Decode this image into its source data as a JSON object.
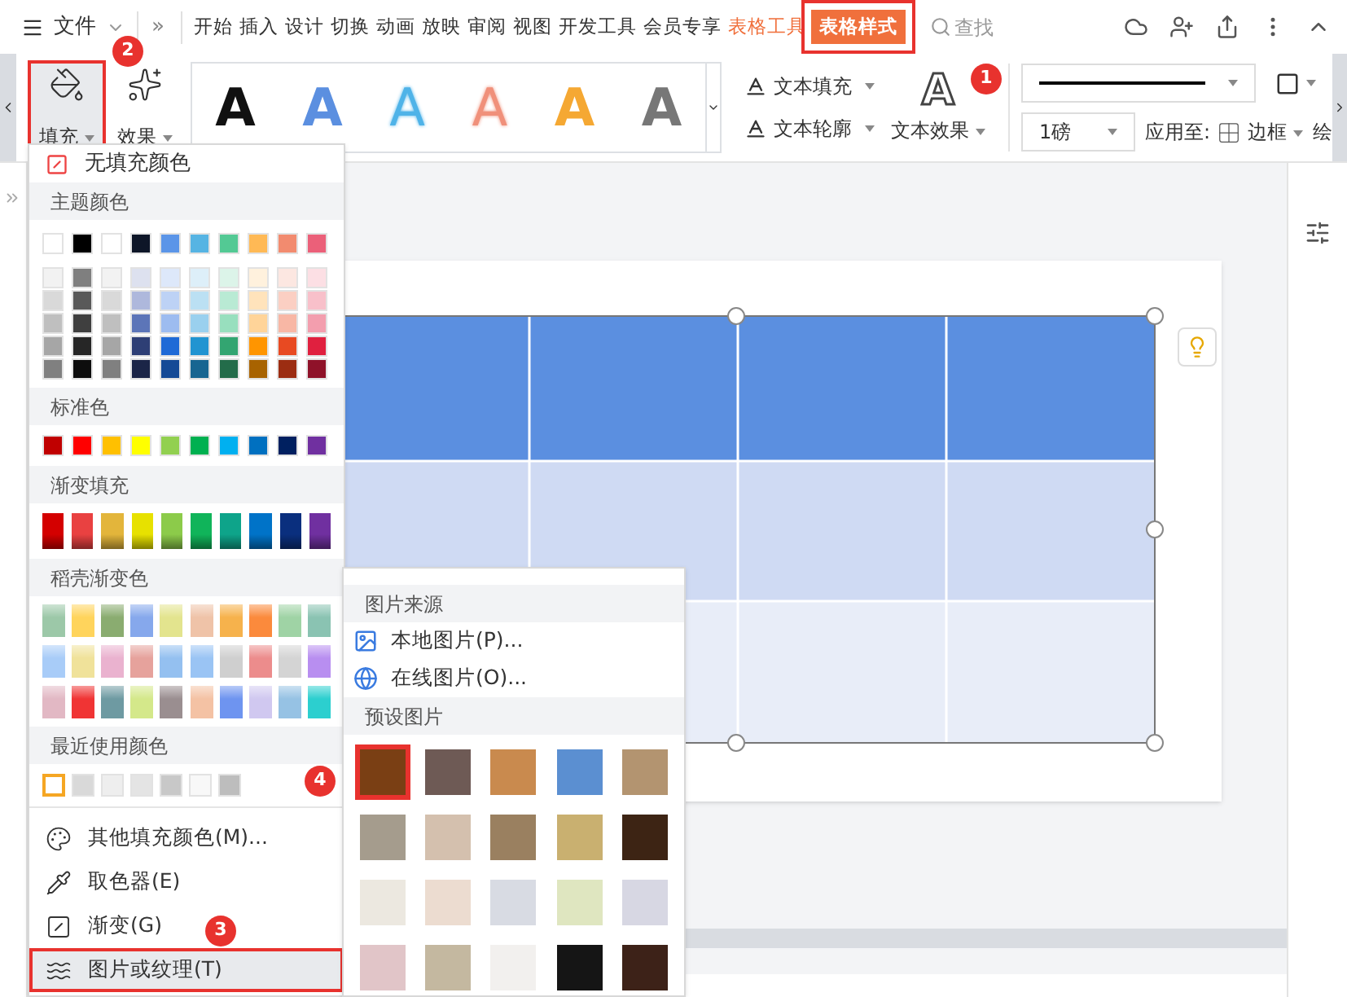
{
  "menu_bar": {
    "file_label": "文件",
    "overflow_label": "»"
  },
  "tabs": [
    {
      "label": "开始",
      "kind": "normal",
      "selected": false
    },
    {
      "label": "插入",
      "kind": "normal",
      "selected": false
    },
    {
      "label": "设计",
      "kind": "normal",
      "selected": false
    },
    {
      "label": "切换",
      "kind": "normal",
      "selected": false
    },
    {
      "label": "动画",
      "kind": "normal",
      "selected": false
    },
    {
      "label": "放映",
      "kind": "normal",
      "selected": false
    },
    {
      "label": "审阅",
      "kind": "normal",
      "selected": false
    },
    {
      "label": "视图",
      "kind": "normal",
      "selected": false
    },
    {
      "label": "开发工具",
      "kind": "normal",
      "selected": false
    },
    {
      "label": "会员专享",
      "kind": "normal",
      "selected": false
    },
    {
      "label": "表格工具",
      "kind": "context",
      "selected": false
    },
    {
      "label": "表格样式",
      "kind": "context",
      "selected": true
    }
  ],
  "search": {
    "label": "查找"
  },
  "ribbon": {
    "fill_button": {
      "label": "填充",
      "pressed": true
    },
    "effect_button": {
      "label": "效果"
    },
    "text_styles": [
      {
        "glyph": "A",
        "kind": "fill",
        "color": "#111111"
      },
      {
        "glyph": "A",
        "kind": "fill",
        "color": "#5b8fe0"
      },
      {
        "glyph": "A",
        "kind": "outline",
        "color": "#4fb3e8"
      },
      {
        "glyph": "A",
        "kind": "outline",
        "color": "#f0907a"
      },
      {
        "glyph": "A",
        "kind": "fill",
        "color": "#f5a833"
      },
      {
        "glyph": "A",
        "kind": "fill",
        "color": "#777777"
      }
    ],
    "text_fill": "文本填充",
    "text_outline": "文本轮廓",
    "text_effect_glyph": "A",
    "text_effect": "文本效果",
    "line_weight": "1磅",
    "apply_to": "应用至:",
    "border": "边框",
    "draw": "绘"
  },
  "fill_menu": {
    "no_fill": "无填充颜色",
    "theme_header": "主题颜色",
    "theme_top": [
      {
        "color": "#ffffff"
      },
      {
        "color": "#000000"
      },
      {
        "color": "#ffffff"
      },
      {
        "color": "#0e1628"
      },
      {
        "color": "#5b95e8"
      },
      {
        "color": "#56b4e3"
      },
      {
        "color": "#53c994"
      },
      {
        "color": "#ffb955"
      },
      {
        "color": "#f28b6f"
      },
      {
        "color": "#eb6079"
      }
    ],
    "theme_shades": [
      [
        {
          "color": "#f2f2f2"
        },
        {
          "color": "#7f7f7f"
        },
        {
          "color": "#f2f2f2"
        },
        {
          "color": "#dde1ef"
        },
        {
          "color": "#dde8fa"
        },
        {
          "color": "#ddeff9"
        },
        {
          "color": "#dcf4e9"
        },
        {
          "color": "#fff1dd"
        },
        {
          "color": "#fce7e1"
        },
        {
          "color": "#fcdfe4"
        }
      ],
      [
        {
          "color": "#d9d9d9"
        },
        {
          "color": "#595959"
        },
        {
          "color": "#d9d9d9"
        },
        {
          "color": "#aeb8dc"
        },
        {
          "color": "#bdd2f5"
        },
        {
          "color": "#bbe0f3"
        },
        {
          "color": "#b9ead4"
        },
        {
          "color": "#ffe3bb"
        },
        {
          "color": "#fbcfc3"
        },
        {
          "color": "#f8c0ca"
        }
      ],
      [
        {
          "color": "#bfbfbf"
        },
        {
          "color": "#3f3f3f"
        },
        {
          "color": "#bfbfbf"
        },
        {
          "color": "#5c75b8"
        },
        {
          "color": "#9dbcf0"
        },
        {
          "color": "#9ad0ee"
        },
        {
          "color": "#98dfbe"
        },
        {
          "color": "#ffd499"
        },
        {
          "color": "#f8b7a5"
        },
        {
          "color": "#f39eae"
        }
      ],
      [
        {
          "color": "#a6a6a6"
        },
        {
          "color": "#262626"
        },
        {
          "color": "#a6a6a6"
        },
        {
          "color": "#2e3f75"
        },
        {
          "color": "#1f6ad6"
        },
        {
          "color": "#2194d1"
        },
        {
          "color": "#33a571"
        },
        {
          "color": "#ff9500"
        },
        {
          "color": "#e84a22"
        },
        {
          "color": "#e0203f"
        }
      ],
      [
        {
          "color": "#808080"
        },
        {
          "color": "#0d0d0d"
        },
        {
          "color": "#808080"
        },
        {
          "color": "#1b2547"
        },
        {
          "color": "#154a96"
        },
        {
          "color": "#176591"
        },
        {
          "color": "#236c4a"
        },
        {
          "color": "#a86300"
        },
        {
          "color": "#9c2d12"
        },
        {
          "color": "#8f1229"
        }
      ]
    ],
    "standard_header": "标准色",
    "standard": [
      {
        "color": "#c00000"
      },
      {
        "color": "#ff0000"
      },
      {
        "color": "#ffc000"
      },
      {
        "color": "#ffff00"
      },
      {
        "color": "#92d050"
      },
      {
        "color": "#00b050"
      },
      {
        "color": "#00b0f0"
      },
      {
        "color": "#0070c0"
      },
      {
        "color": "#002060"
      },
      {
        "color": "#7030a0"
      }
    ],
    "gradient_header": "渐变填充",
    "gradients": [
      {
        "color": "#d40000"
      },
      {
        "color": "#e94141"
      },
      {
        "color": "#e3b53b"
      },
      {
        "color": "#e7e100"
      },
      {
        "color": "#8ccb4a"
      },
      {
        "color": "#10b45a"
      },
      {
        "color": "#0ea48a"
      },
      {
        "color": "#0073c8"
      },
      {
        "color": "#0a2f7e"
      },
      {
        "color": "#7030a0"
      }
    ],
    "docer_header": "稻壳渐变色",
    "docer": [
      {
        "color": "#9cc8a8"
      },
      {
        "color": "#ffd45c"
      },
      {
        "color": "#8aac70"
      },
      {
        "color": "#86a8ec"
      },
      {
        "color": "#e3e48e"
      },
      {
        "color": "#efc3a8"
      },
      {
        "color": "#f6b24c"
      },
      {
        "color": "#fb8a3c"
      },
      {
        "color": "#9fd3a5"
      },
      {
        "color": "#8ac3b2"
      },
      {
        "color": "#a8ccf8"
      },
      {
        "color": "#f0e29a"
      },
      {
        "color": "#eab2cf"
      },
      {
        "color": "#e6a29c"
      },
      {
        "color": "#94c0f0"
      },
      {
        "color": "#9ac4f4"
      },
      {
        "color": "#cfcfcf"
      },
      {
        "color": "#ec8c8c"
      },
      {
        "color": "#d4d4d4"
      },
      {
        "color": "#b88ef0"
      },
      {
        "color": "#e2b8c4"
      },
      {
        "color": "#f03434"
      },
      {
        "color": "#6e9aa2"
      },
      {
        "color": "#d4e88a"
      },
      {
        "color": "#9a8e90"
      },
      {
        "color": "#f4c2a4"
      },
      {
        "color": "#6e94f0"
      },
      {
        "color": "#d0c8f0"
      },
      {
        "color": "#96c2e4"
      },
      {
        "color": "#2ccfcf"
      }
    ],
    "recent_header": "最近使用颜色",
    "recent": [
      {
        "color": "#ffffff",
        "selected": true
      },
      {
        "color": "#d9d9d9",
        "selected": false
      },
      {
        "color": "#eeeeee",
        "selected": false
      },
      {
        "color": "#e4e4e4",
        "selected": false
      },
      {
        "color": "#c8c8c8",
        "selected": false
      },
      {
        "color": "#f8f8f8",
        "selected": false
      },
      {
        "color": "#bdbdbd",
        "selected": false
      }
    ],
    "commands": [
      {
        "label": "其他填充颜色(M)...",
        "kind": "palette",
        "highlighted": false
      },
      {
        "label": "取色器(E)",
        "kind": "eyedropper",
        "highlighted": false
      },
      {
        "label": "渐变(G)",
        "kind": "gradient",
        "highlighted": false
      },
      {
        "label": "图片或纹理(T)",
        "kind": "texture",
        "highlighted": true
      }
    ]
  },
  "texture_menu": {
    "source_header": "图片来源",
    "sources": [
      {
        "label": "本地图片(P)...",
        "kind": "local"
      },
      {
        "label": "在线图片(O)...",
        "kind": "online"
      }
    ],
    "preset_header": "预设图片",
    "textures": [
      {
        "color": "#7a3f14",
        "selected": true
      },
      {
        "color": "#6e5a55",
        "selected": false
      },
      {
        "color": "#c98a4e",
        "selected": false
      },
      {
        "color": "#5b8fd1",
        "selected": false
      },
      {
        "color": "#b39470",
        "selected": false
      },
      {
        "color": "#a59c8d",
        "selected": false
      },
      {
        "color": "#d4c0ae",
        "selected": false
      },
      {
        "color": "#9a8060",
        "selected": false
      },
      {
        "color": "#c9b070",
        "selected": false
      },
      {
        "color": "#3d2414",
        "selected": false
      },
      {
        "color": "#ece8e0",
        "selected": false
      },
      {
        "color": "#ecdcd0",
        "selected": false
      },
      {
        "color": "#d8dbe3",
        "selected": false
      },
      {
        "color": "#dfe6c0",
        "selected": false
      },
      {
        "color": "#d7d7e3",
        "selected": false
      },
      {
        "color": "#e1c5c8",
        "selected": false
      },
      {
        "color": "#c4b8a0",
        "selected": false
      },
      {
        "color": "#f2f0ee",
        "selected": false
      },
      {
        "color": "#151515",
        "selected": false
      },
      {
        "color": "#3d2218",
        "selected": false
      }
    ]
  },
  "callouts": [
    {
      "number": "1"
    },
    {
      "number": "2"
    },
    {
      "number": "3"
    },
    {
      "number": "4"
    }
  ]
}
